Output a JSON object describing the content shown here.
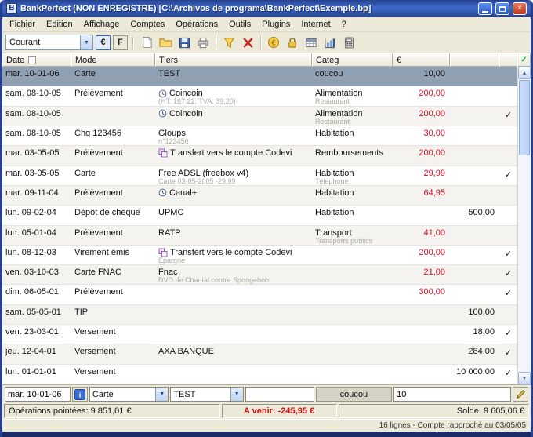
{
  "window": {
    "title": "BankPerfect (NON ENREGISTRE) [C:\\Archivos de programa\\BankPerfect\\Exemple.bp]"
  },
  "menu": {
    "items": [
      "Fichier",
      "Edition",
      "Affichage",
      "Comptes",
      "Opérations",
      "Outils",
      "Plugins",
      "Internet",
      "?"
    ]
  },
  "toolbar": {
    "account": "Courant",
    "euro": "€",
    "franc": "F",
    "groups": [
      [
        "new-file-icon",
        "open-folder-icon",
        "save-icon",
        "print-icon"
      ],
      [
        "filter-icon",
        "clear-filter-icon"
      ],
      [
        "bank-icon",
        "lock-icon",
        "table-icon",
        "chart-icon",
        "calculator-icon"
      ]
    ]
  },
  "table": {
    "headers": {
      "date": "Date",
      "mode": "Mode",
      "tiers": "Tiers",
      "categ": "Categ",
      "amount": "€"
    },
    "rows": [
      {
        "date": "mar. 10-01-06",
        "mode": "Carte",
        "tiers": "TEST",
        "categ": "coucou",
        "debit": "10,00",
        "selected": true
      },
      {
        "date": "sam. 08-10-05",
        "mode": "Prélèvement",
        "tiers": "Coincoin",
        "tiers_icon": "clock",
        "tiers_sub": "(HT: 167.22, TVA: 39.20)",
        "categ": "Alimentation",
        "categ_sub": "Restaurant",
        "debit": "200,00"
      },
      {
        "date": "sam. 08-10-05",
        "mode": "",
        "tiers": "Coincoin",
        "tiers_icon": "clock",
        "categ": "Alimentation",
        "categ_sub": "Restaurant",
        "debit": "200,00",
        "checked": true
      },
      {
        "date": "sam. 08-10-05",
        "mode": "Chq 123456",
        "tiers": "Gloups",
        "tiers_sub": "n°123456",
        "categ": "Habitation",
        "debit": "30,00"
      },
      {
        "date": "mar. 03-05-05",
        "mode": "Prélèvement",
        "tiers": "Transfert vers le compte Codevi",
        "tiers_icon": "transfer",
        "categ": "Remboursements",
        "debit": "200,00"
      },
      {
        "date": "mar. 03-05-05",
        "mode": "Carte",
        "tiers": "Free ADSL (freebox v4)",
        "tiers_sub": "Carte 03-05-2005 -29.99",
        "categ": "Habitation",
        "categ_sub": "Téléphone",
        "debit": "29,99",
        "checked": true
      },
      {
        "date": "mar. 09-11-04",
        "mode": "Prélèvement",
        "tiers": "Canal+",
        "tiers_icon": "clock",
        "categ": "Habitation",
        "debit": "64,95"
      },
      {
        "date": "lun. 09-02-04",
        "mode": "Dépôt de chèque",
        "tiers": "UPMC",
        "categ": "Habitation",
        "credit": "500,00"
      },
      {
        "date": "lun. 05-01-04",
        "mode": "Prélèvement",
        "tiers": "RATP",
        "categ": "Transport",
        "categ_sub": "Transports publics",
        "debit": "41,00"
      },
      {
        "date": "lun. 08-12-03",
        "mode": "Virement émis",
        "tiers": "Transfert vers le compte Codevi",
        "tiers_icon": "transfer",
        "tiers_sub": "Epargne",
        "debit": "200,00",
        "checked": true
      },
      {
        "date": "ven. 03-10-03",
        "mode": "Carte FNAC",
        "tiers": "Fnac",
        "tiers_sub": "DVD de Chantal contre Spongebob",
        "debit": "21,00",
        "checked": true
      },
      {
        "date": "dim. 06-05-01",
        "mode": "Prélèvement",
        "debit": "300,00",
        "checked": true
      },
      {
        "date": "sam. 05-05-01",
        "mode": "TIP",
        "credit": "100,00"
      },
      {
        "date": "ven. 23-03-01",
        "mode": "Versement",
        "credit": "18,00",
        "checked": true
      },
      {
        "date": "jeu. 12-04-01",
        "mode": "Versement",
        "tiers": "AXA BANQUE",
        "credit": "284,00",
        "checked": true
      },
      {
        "date": "lun. 01-01-01",
        "mode": "Versement",
        "credit": "10 000,00",
        "checked": true
      }
    ]
  },
  "edit": {
    "date": "mar. 10-01-06",
    "mode": "Carte",
    "tiers": "TEST",
    "comment": "",
    "categ": "coucou",
    "amount": "10"
  },
  "status": {
    "pointed": "Opérations pointées: 9 851,01 €",
    "upcoming": "A venir: -245,95 €",
    "balance": "Solde: 9 605,06 €",
    "footer": "16 lignes - Compte rapproché au 03/05/05"
  }
}
